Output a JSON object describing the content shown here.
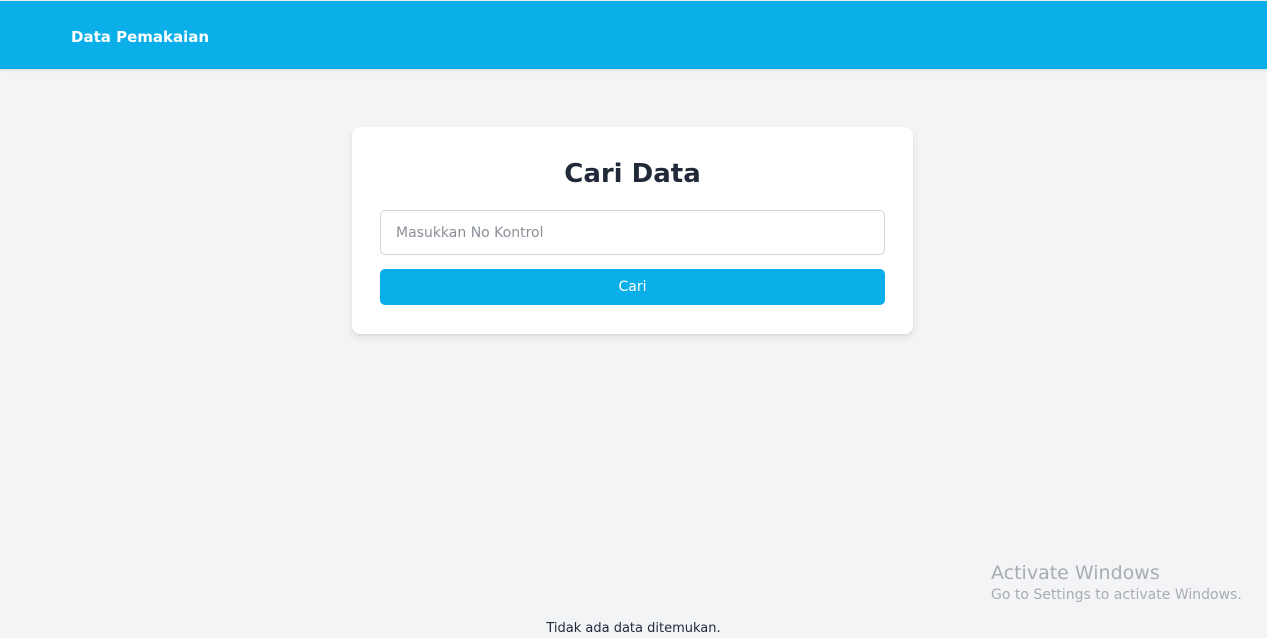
{
  "navbar": {
    "brand": "Data Pemakaian",
    "background_color": "#0aafea"
  },
  "search_card": {
    "title": "Cari Data",
    "input_placeholder": "Masukkan No Kontrol",
    "input_value": "",
    "button_label": "Cari",
    "button_color": "#0aafea"
  },
  "result": {
    "empty_message": "Tidak ada data ditemukan."
  },
  "os_watermark": {
    "title": "Activate Windows",
    "subtitle": "Go to Settings to activate Windows."
  }
}
